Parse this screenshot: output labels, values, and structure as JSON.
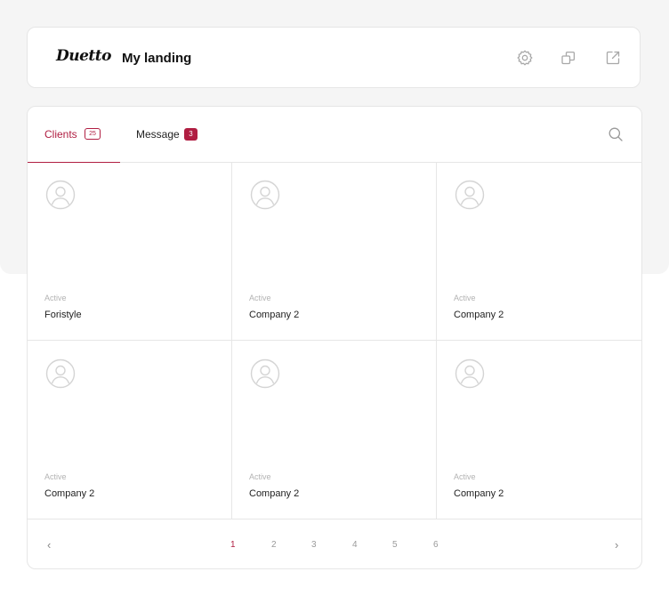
{
  "header": {
    "logo_text": "Duetto",
    "title": "My landing",
    "icons": [
      "gear-icon",
      "copy-icon",
      "external-link-icon"
    ]
  },
  "tabs": [
    {
      "label": "Clients",
      "count": "25",
      "active": true
    },
    {
      "label": "Message",
      "count": "3",
      "active": false
    }
  ],
  "cards": [
    {
      "status": "Active",
      "name": "Foristyle"
    },
    {
      "status": "Active",
      "name": "Company 2"
    },
    {
      "status": "Active",
      "name": "Company 2"
    },
    {
      "status": "Active",
      "name": "Company 2"
    },
    {
      "status": "Active",
      "name": "Company 2"
    },
    {
      "status": "Active",
      "name": "Company 2"
    }
  ],
  "pagination": {
    "prev": "‹",
    "next": "›",
    "pages": [
      "1",
      "2",
      "3",
      "4",
      "5",
      "6"
    ],
    "current": "1"
  },
  "colors": {
    "accent": "#b01e42",
    "border": "#e6e6e6",
    "background": "#f5f5f5"
  }
}
